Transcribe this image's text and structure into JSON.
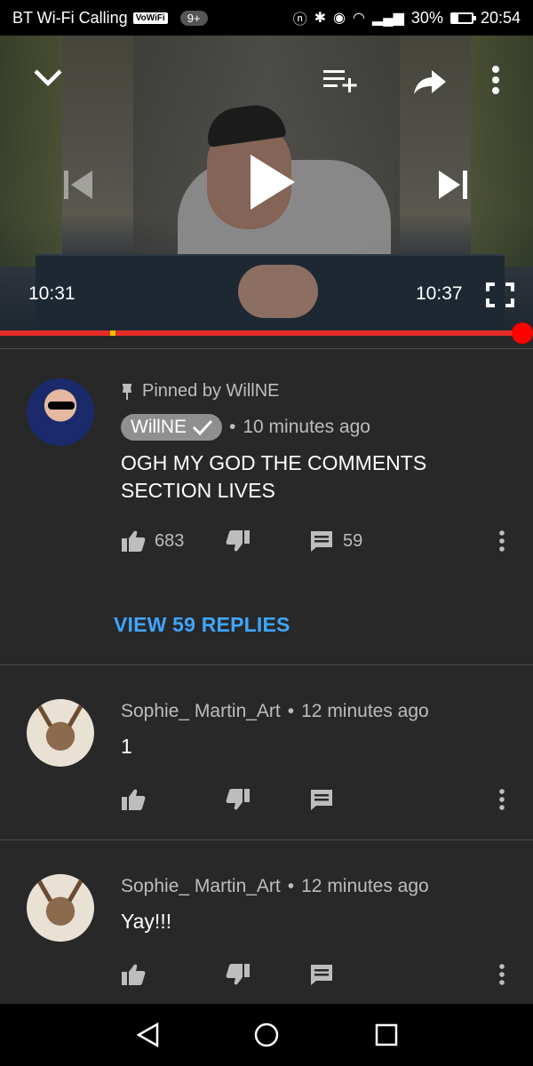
{
  "status_bar": {
    "carrier": "BT Wi-Fi Calling",
    "vowifi": "VoWiFi",
    "notif_count": "9+",
    "battery": "30%",
    "time": "20:54"
  },
  "player": {
    "current_time": "10:31",
    "total_time": "10:37",
    "progress": 0.97
  },
  "pinned_comment": {
    "pinned_label": "Pinned by WillNE",
    "author": "WillNE",
    "time_ago": "10 minutes ago",
    "text": "OGH MY GOD THE COMMENTS SECTION LIVES",
    "likes": "683",
    "replies": "59",
    "view_replies": "VIEW 59 REPLIES"
  },
  "comments": [
    {
      "author": "Sophie_ Martin_Art",
      "time_ago": "12 minutes ago",
      "text": "1"
    },
    {
      "author": "Sophie_ Martin_Art",
      "time_ago": "12 minutes ago",
      "text": "Yay!!!"
    }
  ],
  "colors": {
    "background": "#282828",
    "accent_blue": "#3ea6ff",
    "progress_red": "#ff0000"
  },
  "icons": [
    "chevron-down-icon",
    "add-to-queue-icon",
    "share-icon",
    "more-vert-icon",
    "skip-previous-icon",
    "play-icon",
    "skip-next-icon",
    "fullscreen-icon",
    "pin-icon",
    "verified-check-icon",
    "thumbs-up-icon",
    "thumbs-down-icon",
    "reply-icon",
    "back-icon",
    "home-icon",
    "recent-apps-icon"
  ]
}
